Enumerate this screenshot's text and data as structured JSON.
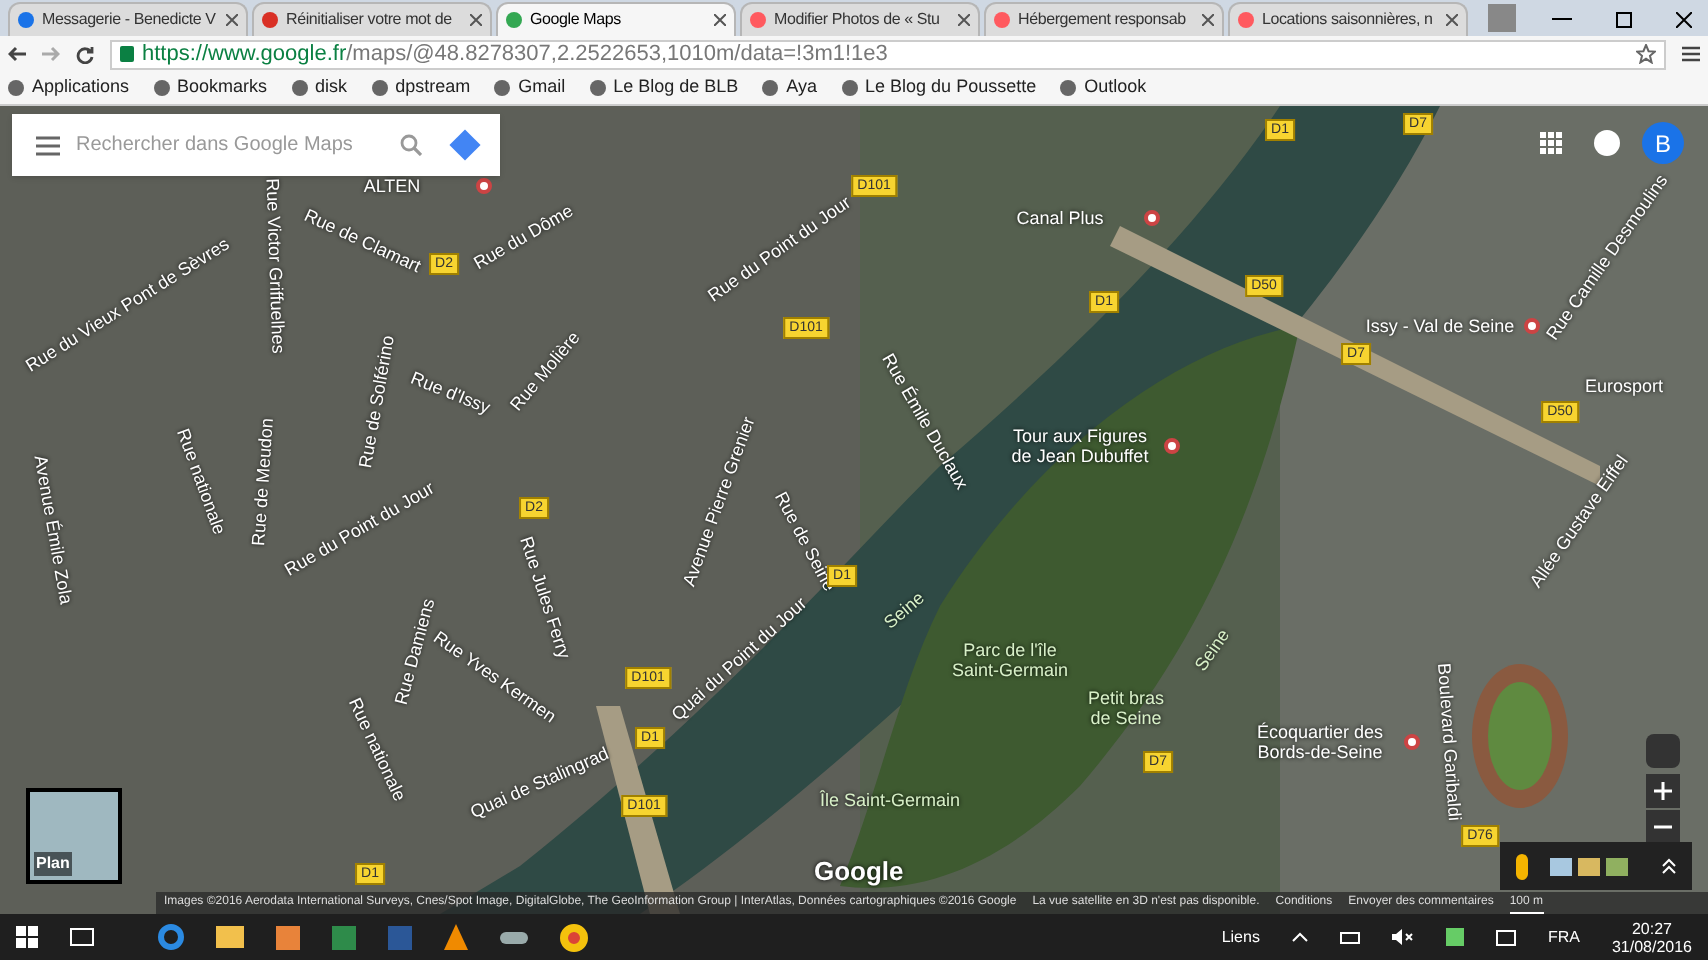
{
  "tabs": [
    {
      "label": "Messagerie - Benedicte V",
      "selected": false
    },
    {
      "label": "Réinitialiser votre mot de",
      "selected": false
    },
    {
      "label": "Google Maps",
      "selected": true
    },
    {
      "label": "Modifier Photos de « Stu",
      "selected": false
    },
    {
      "label": "Hébergement responsab",
      "selected": false
    },
    {
      "label": "Locations saisonnières, n",
      "selected": false
    }
  ],
  "address": {
    "host": "https://www.google.fr",
    "path": "/maps/@48.8278307,2.2522653,1010m/data=!3m1!1e3"
  },
  "bookmarks": [
    "Applications",
    "Bookmarks",
    "disk",
    "dpstream",
    "Gmail",
    "Le Blog de BLB",
    "Aya",
    "Le Blog du Poussette",
    "Outlook"
  ],
  "search": {
    "placeholder": "Rechercher dans Google Maps"
  },
  "account": {
    "initial": "B"
  },
  "places": [
    {
      "lines": [
        "ALTEN"
      ]
    },
    {
      "lines": [
        "Canal Plus"
      ]
    },
    {
      "lines": [
        "Tour aux Figures",
        "de Jean Dubuffet"
      ]
    },
    {
      "lines": [
        "Issy - Val de Seine"
      ]
    },
    {
      "lines": [
        "Eurosport"
      ]
    },
    {
      "lines": [
        "Écoquartier des",
        "Bords-de-Seine"
      ]
    }
  ],
  "areas": [
    {
      "lines": [
        "Parc de l'île",
        "Saint-Germain"
      ]
    },
    {
      "lines": [
        "Petit bras",
        "de Seine"
      ]
    },
    {
      "lines": [
        "Île Saint-Germain"
      ]
    },
    {
      "lines": [
        "Seine"
      ]
    },
    {
      "lines": [
        "Seine"
      ]
    }
  ],
  "streets": [
    "Rue du Vieux Pont de Sèvres",
    "Rue Victor Griffuelhes",
    "Rue de Clamart",
    "Rue du Dôme",
    "Rue de Solférino",
    "Rue d'Issy",
    "Rue Molière",
    "Rue du Point du Jour",
    "Rue du Point du Jour",
    "Rue de Meudon",
    "Rue nationale",
    "Avenue Émile Zola",
    "Rue Émile Duclaux",
    "Avenue Pierre Grenier",
    "Rue de Seine",
    "Rue Yves Kermen",
    "Rue Damiens",
    "Rue nationale",
    "Rue Jules Ferry",
    "Quai du Point du Jour",
    "Quai de Stalingrad",
    "Rue Camille Desmoulins",
    "Allée Gustave Eiffel",
    "Boulevard Garibaldi"
  ],
  "roads": [
    "D101",
    "D2",
    "D1",
    "D50",
    "D7",
    "D50",
    "D101",
    "D2",
    "D1",
    "D1",
    "D7",
    "D101",
    "D1",
    "D101",
    "D1",
    "D7",
    "D76"
  ],
  "map_type": {
    "label": "Plan"
  },
  "logo": "Google",
  "footer": {
    "attribution": "Images ©2016 Aerodata International Surveys, Cnes/Spot Image, DigitalGlobe, The GeoInformation Group | InterAtlas, Données cartographiques ©2016 Google",
    "notice": "La vue satellite en 3D n'est pas disponible.",
    "links": [
      "Conditions",
      "Envoyer des commentaires"
    ],
    "scale": "100 m"
  },
  "taskbar": {
    "links": "Liens",
    "language": "FRA",
    "time": "20:27",
    "date": "31/08/2016"
  }
}
